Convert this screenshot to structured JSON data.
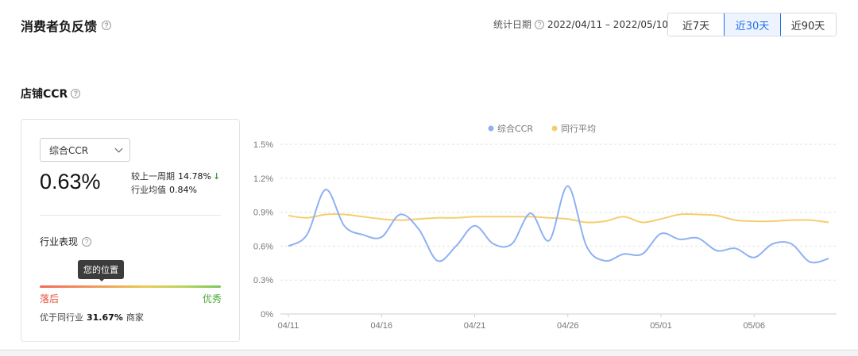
{
  "header": {
    "title": "消费者负反馈",
    "help_icon": "?",
    "date_label": "统计日期",
    "date_value": "2022/04/11 – 2022/05/10",
    "ranges": [
      "近7天",
      "近30天",
      "近90天"
    ],
    "active_range": "近30天"
  },
  "section": {
    "title": "店铺CCR"
  },
  "card": {
    "select_value": "综合CCR",
    "big_value": "0.63%",
    "compare_label": "较上一周期",
    "compare_value": "14.78%",
    "compare_arrow": "↓",
    "industry_avg_label": "行业均值",
    "industry_avg_value": "0.84%",
    "performance_title": "行业表现",
    "tooltip": "您的位置",
    "position_fraction": 0.34,
    "low_label": "落后",
    "high_label": "优秀",
    "beat_prefix": "优于同行业",
    "beat_pct": "31.67%",
    "beat_suffix": "商家"
  },
  "colors": {
    "accent": "#1f6fe5",
    "series_ccr": "#8fb1f2",
    "series_avg": "#f5cd6c",
    "low": "#e4533f",
    "high": "#4aa838"
  },
  "chart_data": {
    "type": "line",
    "x": [
      "04/11",
      "04/12",
      "04/13",
      "04/14",
      "04/15",
      "04/16",
      "04/17",
      "04/18",
      "04/19",
      "04/20",
      "04/21",
      "04/22",
      "04/23",
      "04/24",
      "04/25",
      "04/26",
      "04/27",
      "04/28",
      "04/29",
      "04/30",
      "05/01",
      "05/02",
      "05/03",
      "05/04",
      "05/05",
      "05/06",
      "05/07",
      "05/08",
      "05/09",
      "05/10"
    ],
    "x_tick_labels": [
      "04/11",
      "04/16",
      "04/21",
      "04/26",
      "05/01",
      "05/06"
    ],
    "y_tick_labels": [
      "0%",
      "0.3%",
      "0.6%",
      "0.9%",
      "1.2%",
      "1.5%"
    ],
    "ylim": [
      0,
      1.5
    ],
    "series": [
      {
        "name": "综合CCR",
        "values": [
          0.6,
          0.7,
          1.1,
          0.78,
          0.7,
          0.68,
          0.88,
          0.75,
          0.47,
          0.6,
          0.78,
          0.62,
          0.62,
          0.89,
          0.65,
          1.13,
          0.6,
          0.47,
          0.53,
          0.53,
          0.71,
          0.66,
          0.67,
          0.56,
          0.58,
          0.5,
          0.62,
          0.62,
          0.46,
          0.49
        ]
      },
      {
        "name": "同行平均",
        "values": [
          0.87,
          0.85,
          0.88,
          0.88,
          0.86,
          0.84,
          0.83,
          0.84,
          0.85,
          0.85,
          0.86,
          0.86,
          0.86,
          0.86,
          0.85,
          0.84,
          0.81,
          0.82,
          0.86,
          0.81,
          0.84,
          0.88,
          0.88,
          0.87,
          0.83,
          0.82,
          0.82,
          0.83,
          0.83,
          0.81
        ]
      }
    ],
    "legend_position": "top-center",
    "grid": true
  }
}
